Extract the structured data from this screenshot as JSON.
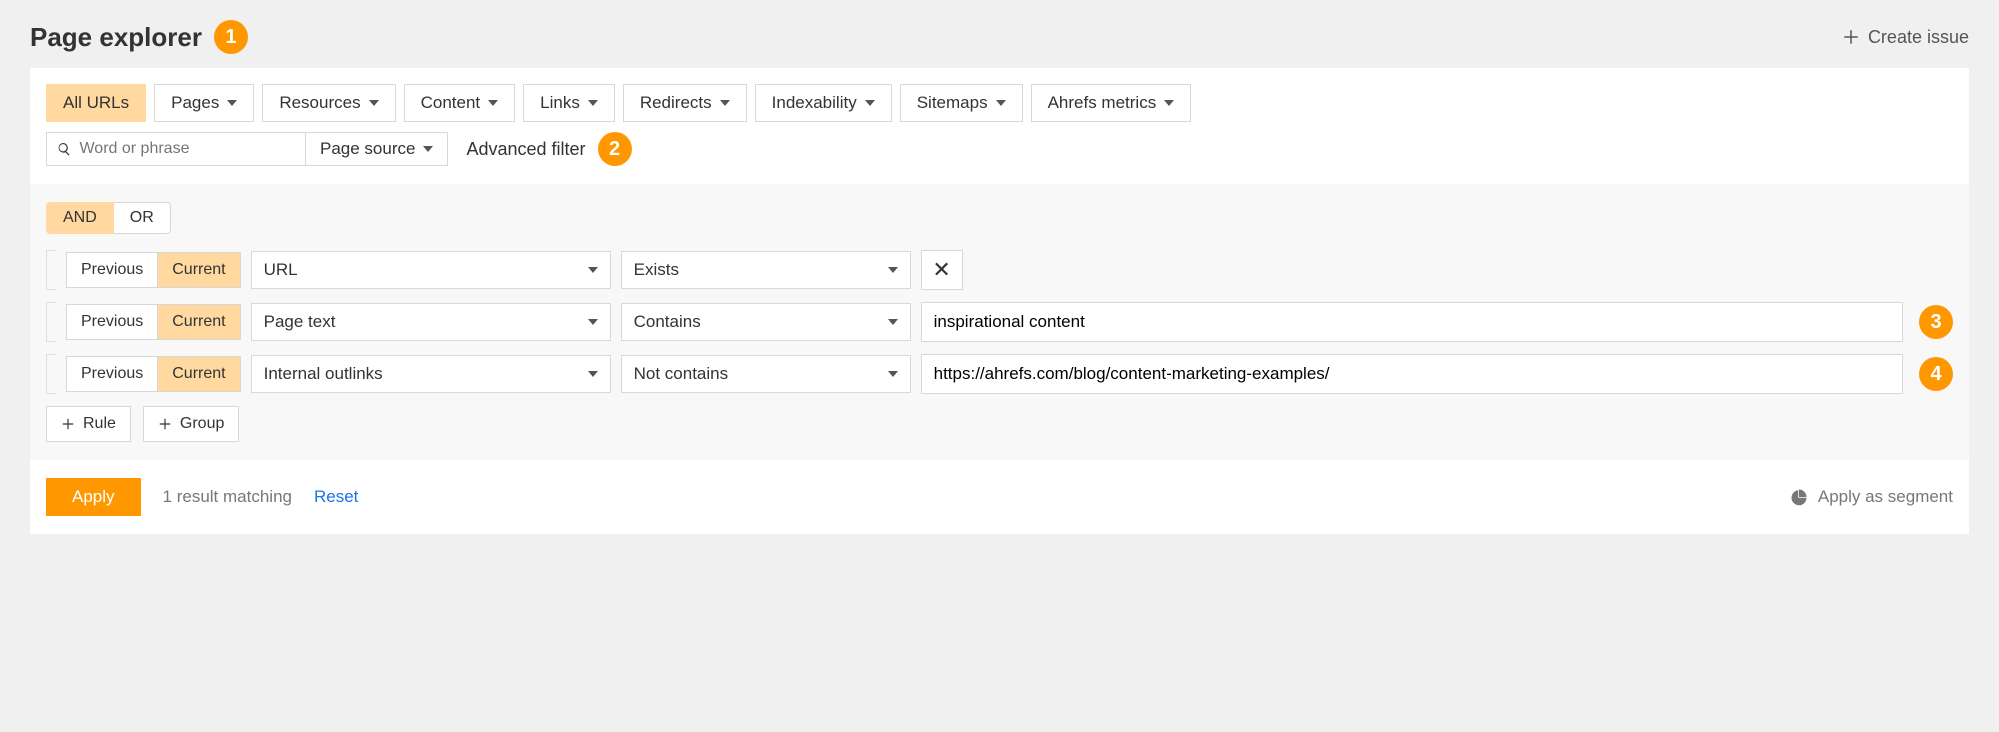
{
  "header": {
    "title": "Page explorer",
    "create_issue": "Create issue"
  },
  "annot": {
    "a1": "1",
    "a2": "2",
    "a3": "3",
    "a4": "4"
  },
  "tabs": {
    "all_urls": "All URLs",
    "pages": "Pages",
    "resources": "Resources",
    "content": "Content",
    "links": "Links",
    "redirects": "Redirects",
    "indexability": "Indexability",
    "sitemaps": "Sitemaps",
    "ahrefs_metrics": "Ahrefs metrics"
  },
  "search": {
    "placeholder": "Word or phrase",
    "source_label": "Page source",
    "advanced_label": "Advanced filter"
  },
  "logic": {
    "and": "AND",
    "or": "OR"
  },
  "rules": [
    {
      "prev": "Previous",
      "curr": "Current",
      "field": "URL",
      "op": "Exists",
      "value": "",
      "hasValue": false
    },
    {
      "prev": "Previous",
      "curr": "Current",
      "field": "Page text",
      "op": "Contains",
      "value": "inspirational content",
      "hasValue": true
    },
    {
      "prev": "Previous",
      "curr": "Current",
      "field": "Internal outlinks",
      "op": "Not contains",
      "value": "https://ahrefs.com/blog/content-marketing-examples/",
      "hasValue": true
    }
  ],
  "add": {
    "rule": "Rule",
    "group": "Group"
  },
  "footer": {
    "apply": "Apply",
    "result": "1 result matching",
    "reset": "Reset",
    "segment": "Apply as segment"
  }
}
